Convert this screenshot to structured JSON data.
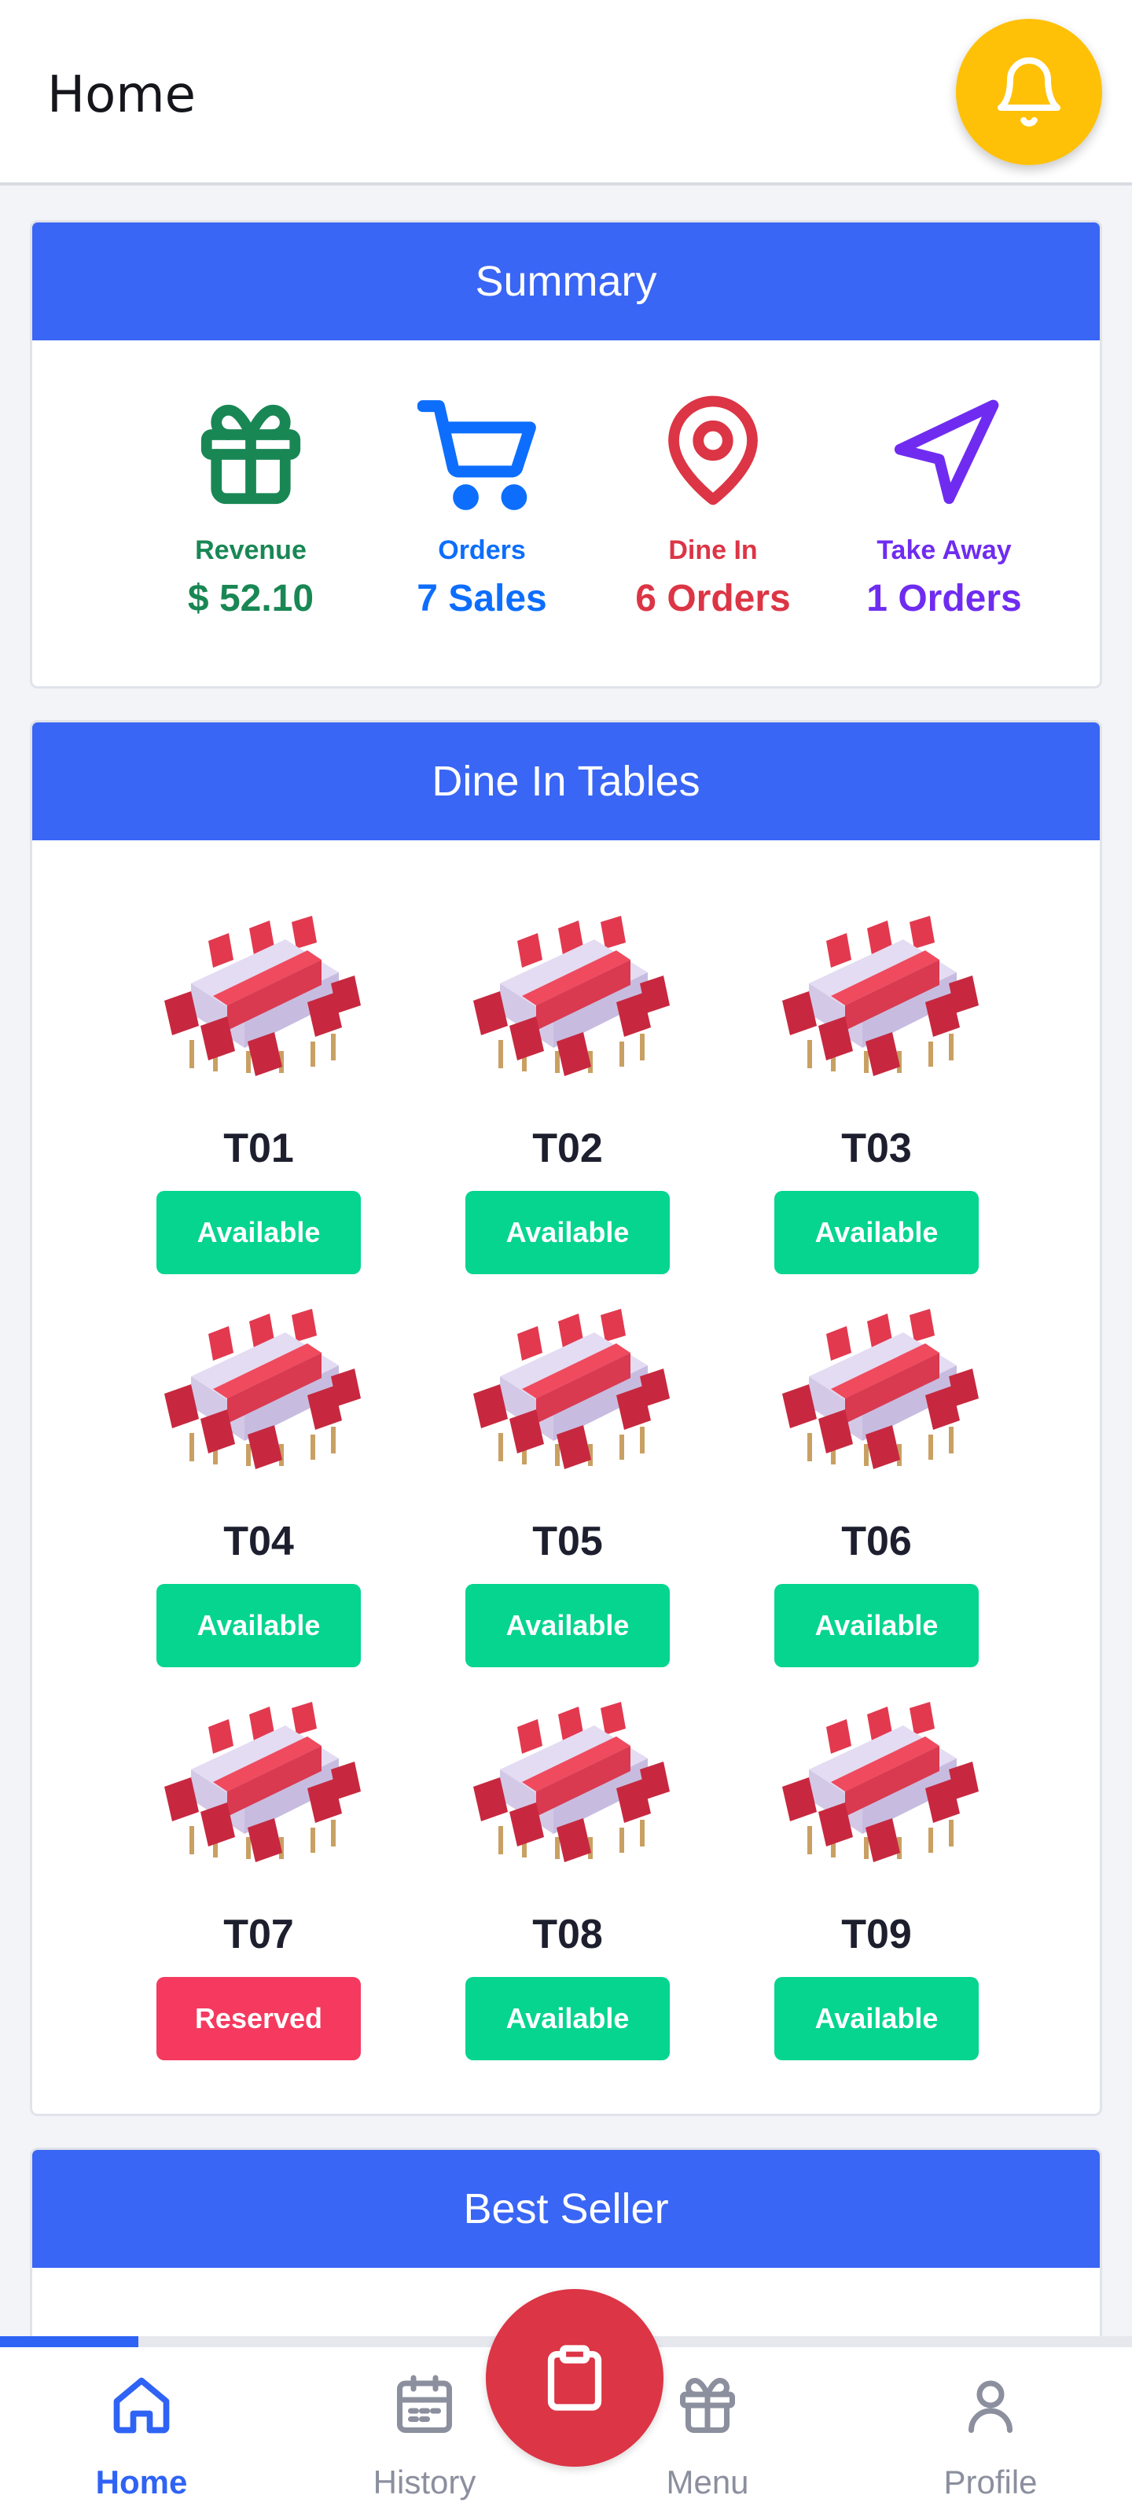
{
  "header": {
    "title": "Home",
    "notification_icon": "bell-icon"
  },
  "summary": {
    "title": "Summary",
    "stats": [
      {
        "icon": "gift-icon",
        "label": "Revenue",
        "value": "$ 52.10",
        "color": "#198754"
      },
      {
        "icon": "cart-icon",
        "label": "Orders",
        "value": "7 Sales",
        "color": "#0d6efd"
      },
      {
        "icon": "map-pin-icon",
        "label": "Dine In",
        "value": "6 Orders",
        "color": "#dc3545"
      },
      {
        "icon": "navigation-icon",
        "label": "Take Away",
        "value": "1 Orders",
        "color": "#6f2cf0"
      }
    ]
  },
  "dine_in": {
    "title": "Dine In Tables",
    "tables": [
      {
        "name": "T01",
        "status": "Available"
      },
      {
        "name": "T02",
        "status": "Available"
      },
      {
        "name": "T03",
        "status": "Available"
      },
      {
        "name": "T04",
        "status": "Available"
      },
      {
        "name": "T05",
        "status": "Available"
      },
      {
        "name": "T06",
        "status": "Available"
      },
      {
        "name": "T07",
        "status": "Reserved"
      },
      {
        "name": "T08",
        "status": "Available"
      },
      {
        "name": "T09",
        "status": "Available"
      }
    ]
  },
  "best_seller": {
    "title": "Best Seller"
  },
  "bottom_nav": {
    "progress": 0.25,
    "items": [
      {
        "icon": "home-icon",
        "label": "Home",
        "active": true
      },
      {
        "icon": "calendar-icon",
        "label": "History",
        "active": false
      },
      {
        "icon": "gift-icon",
        "label": "Menu",
        "active": false
      },
      {
        "icon": "user-icon",
        "label": "Profile",
        "active": false
      }
    ],
    "fab_icon": "clipboard-icon"
  },
  "colors": {
    "accent": "#3a66f5",
    "available": "#05d58e",
    "reserved": "#f5395f",
    "bell": "#ffc107",
    "fab": "#dc3545"
  }
}
